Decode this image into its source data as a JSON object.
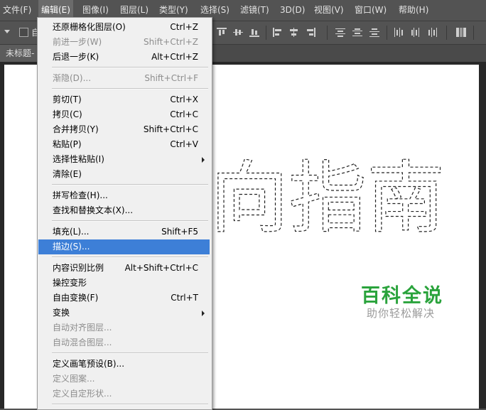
{
  "menubar": {
    "items": [
      "文件(F)",
      "编辑(E)",
      "图像(I)",
      "图层(L)",
      "类型(Y)",
      "选择(S)",
      "滤镜(T)",
      "3D(D)",
      "视图(V)",
      "窗口(W)",
      "帮助(H)"
    ],
    "active": "编辑(E)"
  },
  "toolbar": {
    "auto_select_label": "自"
  },
  "document": {
    "tab_title": "未标题-"
  },
  "canvas": {
    "selection_text": "向指南"
  },
  "watermark": {
    "title": "百科全说",
    "subtitle": "助你轻松解决",
    "title_color": "#2aa33c"
  },
  "edit_menu": {
    "items": [
      {
        "label": "还原栅格化图层(O)",
        "shortcut": "Ctrl+Z",
        "enabled": true
      },
      {
        "label": "前进一步(W)",
        "shortcut": "Shift+Ctrl+Z",
        "enabled": false
      },
      {
        "label": "后退一步(K)",
        "shortcut": "Alt+Ctrl+Z",
        "enabled": true
      },
      {
        "label": "渐隐(D)...",
        "shortcut": "Shift+Ctrl+F",
        "enabled": false
      },
      {
        "label": "剪切(T)",
        "shortcut": "Ctrl+X",
        "enabled": true
      },
      {
        "label": "拷贝(C)",
        "shortcut": "Ctrl+C",
        "enabled": true
      },
      {
        "label": "合并拷贝(Y)",
        "shortcut": "Shift+Ctrl+C",
        "enabled": true
      },
      {
        "label": "粘贴(P)",
        "shortcut": "Ctrl+V",
        "enabled": true
      },
      {
        "label": "选择性粘贴(I)",
        "shortcut": "",
        "enabled": true,
        "submenu": true
      },
      {
        "label": "清除(E)",
        "shortcut": "",
        "enabled": true
      },
      {
        "label": "拼写检查(H)...",
        "shortcut": "",
        "enabled": true
      },
      {
        "label": "查找和替换文本(X)...",
        "shortcut": "",
        "enabled": true
      },
      {
        "label": "填充(L)...",
        "shortcut": "Shift+F5",
        "enabled": true
      },
      {
        "label": "描边(S)...",
        "shortcut": "",
        "enabled": true,
        "highlighted": true
      },
      {
        "label": "内容识别比例",
        "shortcut": "Alt+Shift+Ctrl+C",
        "enabled": true
      },
      {
        "label": "操控变形",
        "shortcut": "",
        "enabled": true
      },
      {
        "label": "自由变换(F)",
        "shortcut": "Ctrl+T",
        "enabled": true
      },
      {
        "label": "变换",
        "shortcut": "",
        "enabled": true,
        "submenu": true
      },
      {
        "label": "自动对齐图层...",
        "shortcut": "",
        "enabled": false
      },
      {
        "label": "自动混合图层...",
        "shortcut": "",
        "enabled": false
      },
      {
        "label": "定义画笔预设(B)...",
        "shortcut": "",
        "enabled": true
      },
      {
        "label": "定义图案...",
        "shortcut": "",
        "enabled": false
      },
      {
        "label": "定义自定形状...",
        "shortcut": "",
        "enabled": false
      }
    ]
  }
}
